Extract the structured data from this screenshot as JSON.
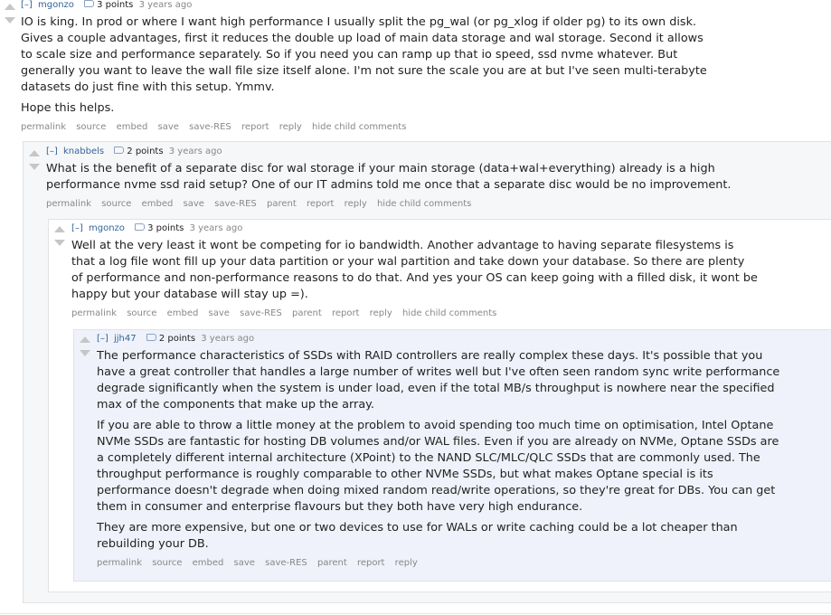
{
  "comments": [
    {
      "expand": "[–]",
      "author": "mgonzo",
      "score": "3 points",
      "age": "3 years ago",
      "paragraphs": [
        "IO is king. In prod or where I want high performance I usually split the pg_wal (or pg_xlog if older pg) to its own disk. Gives a couple advantages, first it reduces the double up load of main data storage and wal storage. Second it allows to scale size and performance separately. So if you need you can ramp up that io speed, ssd nvme whatever. But generally you want to leave the wall file size itself alone. I'm not sure the scale you are at but I've seen multi-terabyte datasets do just fine with this setup. Ymmv.",
        "Hope this helps."
      ],
      "buttons": [
        "permalink",
        "source",
        "embed",
        "save",
        "save-RES",
        "report",
        "reply",
        "hide child comments"
      ]
    },
    {
      "expand": "[–]",
      "author": "knabbels",
      "score": "2 points",
      "age": "3 years ago",
      "paragraphs": [
        "What is the benefit of a separate disc for wal storage if your main storage (data+wal+everything) already is a high performance nvme ssd raid setup? One of our IT admins told me once that a separate disc would be no improvement."
      ],
      "buttons": [
        "permalink",
        "source",
        "embed",
        "save",
        "save-RES",
        "parent",
        "report",
        "reply",
        "hide child comments"
      ]
    },
    {
      "expand": "[–]",
      "author": "mgonzo",
      "score": "3 points",
      "age": "3 years ago",
      "paragraphs": [
        "Well at the very least it wont be competing for io bandwidth. Another advantage to having separate filesystems is that a log file wont fill up your data partition or your wal partition and take down your database. So there are plenty of performance and non-performance reasons to do that. And yes your OS can keep going with a filled disk, it wont be happy but your database will stay up =)."
      ],
      "buttons": [
        "permalink",
        "source",
        "embed",
        "save",
        "save-RES",
        "parent",
        "report",
        "reply",
        "hide child comments"
      ]
    },
    {
      "expand": "[–]",
      "author": "jjh47",
      "score": "2 points",
      "age": "3 years ago",
      "paragraphs": [
        "The performance characteristics of SSDs with RAID controllers are really complex these days. It's possible that you have a great controller that handles a large number of writes well but I've often seen random sync write performance degrade significantly when the system is under load, even if the total MB/s throughput is nowhere near the specified max of the components that make up the array.",
        "If you are able to throw a little money at the problem to avoid spending too much time on optimisation, Intel Optane NVMe SSDs are fantastic for hosting DB volumes and/or WAL files. Even if you are already on NVMe, Optane SSDs are a completely different internal architecture (XPoint) to the NAND SLC/MLC/QLC SSDs that are commonly used. The throughput performance is roughly comparable to other NVMe SSDs, but what makes Optane special is its performance doesn't degrade when doing mixed random read/write operations, so they're great for DBs. You can get them in consumer and enterprise flavours but they both have very high endurance.",
        "They are more expensive, but one or two devices to use for WALs or write caching could be a lot cheaper than rebuilding your DB."
      ],
      "buttons": [
        "permalink",
        "source",
        "embed",
        "save",
        "save-RES",
        "parent",
        "report",
        "reply"
      ]
    }
  ]
}
